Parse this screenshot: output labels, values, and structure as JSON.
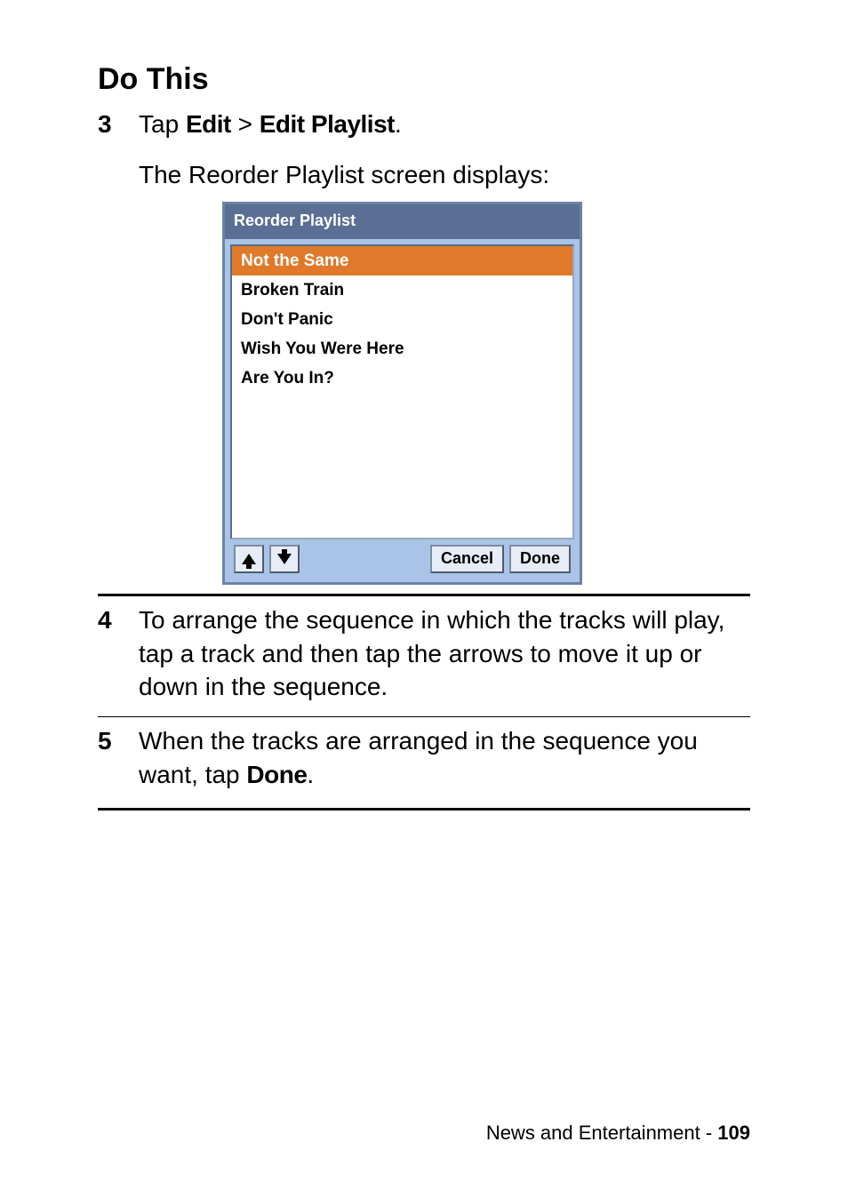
{
  "heading": "Do This",
  "steps": {
    "s3": {
      "num": "3",
      "prefix": "Tap ",
      "bold1": "Edit",
      "mid": " > ",
      "bold2": "Edit Playlist",
      "suffix": ".",
      "sub": "The Reorder Playlist screen displays:"
    },
    "s4": {
      "num": "4",
      "text": "To arrange the sequence in which the tracks will play, tap a track and then tap the arrows to move it up or down in the sequence."
    },
    "s5": {
      "num": "5",
      "prefix": "When the tracks are arranged in the sequence you want, tap ",
      "bold": "Done",
      "suffix": "."
    }
  },
  "screenshot": {
    "title": "Reorder Playlist",
    "items": [
      {
        "label": "Not the Same",
        "selected": true
      },
      {
        "label": "Broken Train",
        "selected": false
      },
      {
        "label": "Don't Panic",
        "selected": false
      },
      {
        "label": "Wish You Were Here",
        "selected": false
      },
      {
        "label": "Are You In?",
        "selected": false
      }
    ],
    "buttons": {
      "cancel": "Cancel",
      "done": "Done"
    }
  },
  "footer": {
    "section": "News and Entertainment",
    "sep": " - ",
    "page": "109"
  }
}
